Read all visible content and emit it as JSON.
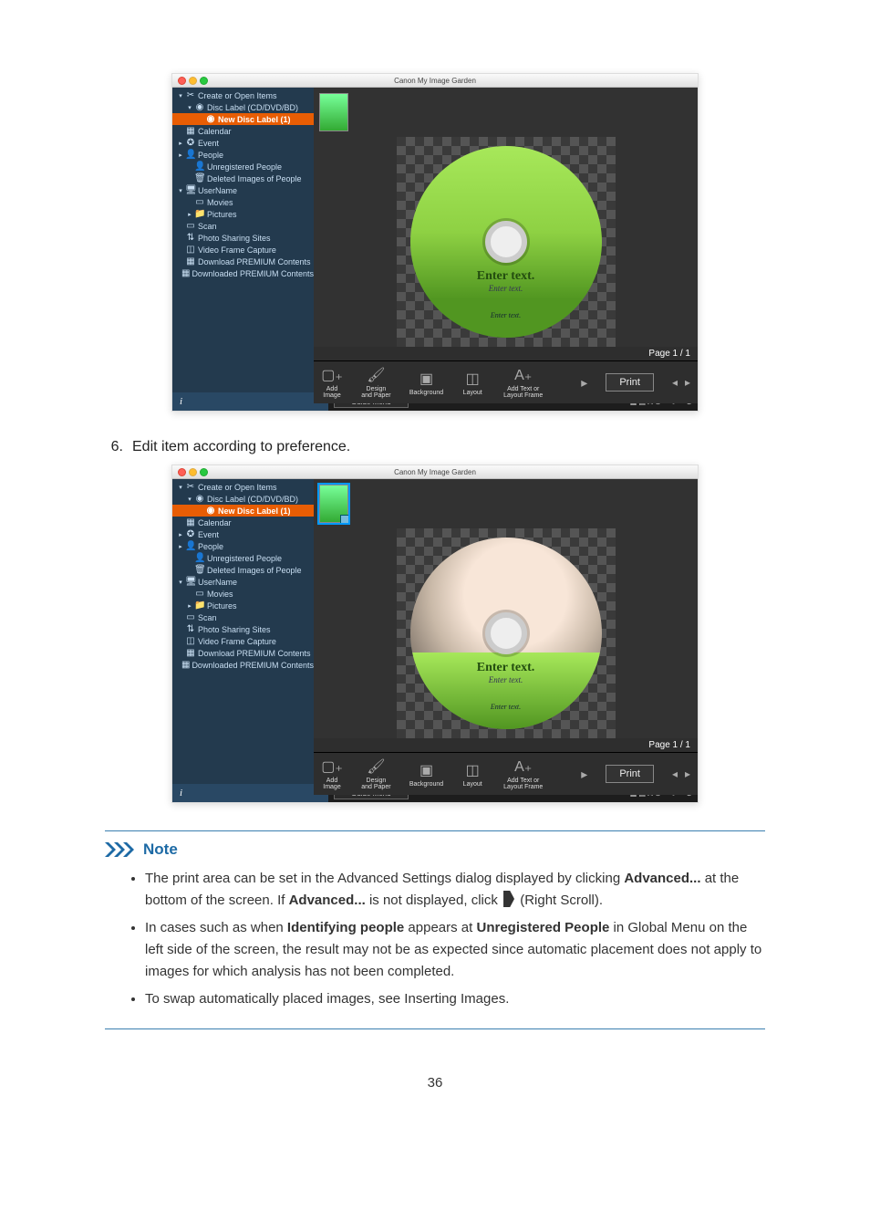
{
  "app": {
    "title": "Canon My Image Garden",
    "page_indicator": "Page 1 / 1",
    "guide_menu_label": "Guide Menu",
    "info_char": "i"
  },
  "sidebar": {
    "items": [
      {
        "depth": 1,
        "arrow": "▾",
        "icon": "✂",
        "label": "Create or Open Items",
        "id": "create-open"
      },
      {
        "depth": 2,
        "arrow": "▾",
        "icon": "◉",
        "label": "Disc Label (CD/DVD/BD)",
        "id": "disc-label"
      },
      {
        "depth": 3,
        "arrow": "",
        "icon": "◉",
        "label": "New Disc Label (1)",
        "id": "new-disc-label",
        "selected": true
      },
      {
        "depth": 1,
        "arrow": "",
        "icon": "▦",
        "label": "Calendar",
        "id": "calendar"
      },
      {
        "depth": 1,
        "arrow": "▸",
        "icon": "✪",
        "label": "Event",
        "id": "event"
      },
      {
        "depth": 1,
        "arrow": "▸",
        "icon": "👤",
        "label": "People",
        "id": "people"
      },
      {
        "depth": 2,
        "arrow": "",
        "icon": "👤",
        "label": "Unregistered People",
        "id": "unregistered-people"
      },
      {
        "depth": 2,
        "arrow": "",
        "icon": "🗑",
        "label": "Deleted Images of People",
        "id": "deleted-images"
      },
      {
        "depth": 1,
        "arrow": "▾",
        "icon": "🖥",
        "label": "UserName",
        "id": "username"
      },
      {
        "depth": 2,
        "arrow": "",
        "icon": "▭",
        "label": "Movies",
        "id": "movies"
      },
      {
        "depth": 2,
        "arrow": "▸",
        "icon": "📁",
        "label": "Pictures",
        "id": "pictures"
      },
      {
        "depth": 1,
        "arrow": "",
        "icon": "▭",
        "label": "Scan",
        "id": "scan"
      },
      {
        "depth": 1,
        "arrow": "",
        "icon": "⇅",
        "label": "Photo Sharing Sites",
        "id": "photo-sharing"
      },
      {
        "depth": 1,
        "arrow": "",
        "icon": "◫",
        "label": "Video Frame Capture",
        "id": "video-frame"
      },
      {
        "depth": 1,
        "arrow": "",
        "icon": "▦",
        "label": "Download PREMIUM Contents",
        "id": "download-premium"
      },
      {
        "depth": 1,
        "arrow": "",
        "icon": "▦",
        "label": "Downloaded PREMIUM Contents",
        "id": "downloaded-premium"
      }
    ]
  },
  "disc_text": {
    "line1": "Enter text.",
    "line2": "Enter text.",
    "line3": "Enter text."
  },
  "toolbar": {
    "add_image": "Add Image",
    "design_paper": "Design and Paper",
    "background": "Background",
    "layout": "Layout",
    "add_text": "Add Text or Layout Frame",
    "print": "Print"
  },
  "doc": {
    "step6": {
      "num": "6.",
      "text": "Edit item according to preference."
    },
    "note_heading": "Note",
    "bullets": {
      "b1_pre": "The print area can be set in the Advanced Settings dialog displayed by clicking ",
      "b1_adv": "Advanced...",
      "b1_mid": " at the bottom of the screen. If ",
      "b1_adv2": "Advanced...",
      "b1_post": " is not displayed, click ",
      "b1_end": " (Right Scroll).",
      "b2_pre": "In cases such as when ",
      "b2_bold1": "Identifying people",
      "b2_mid": " appears at ",
      "b2_bold2": "Unregistered People",
      "b2_post": " in Global Menu on the left side of the screen, the result may not be as expected since automatic placement does not apply to images for which analysis has not been completed.",
      "b3": "To swap automatically placed images, see Inserting Images."
    },
    "page_number": "36"
  }
}
